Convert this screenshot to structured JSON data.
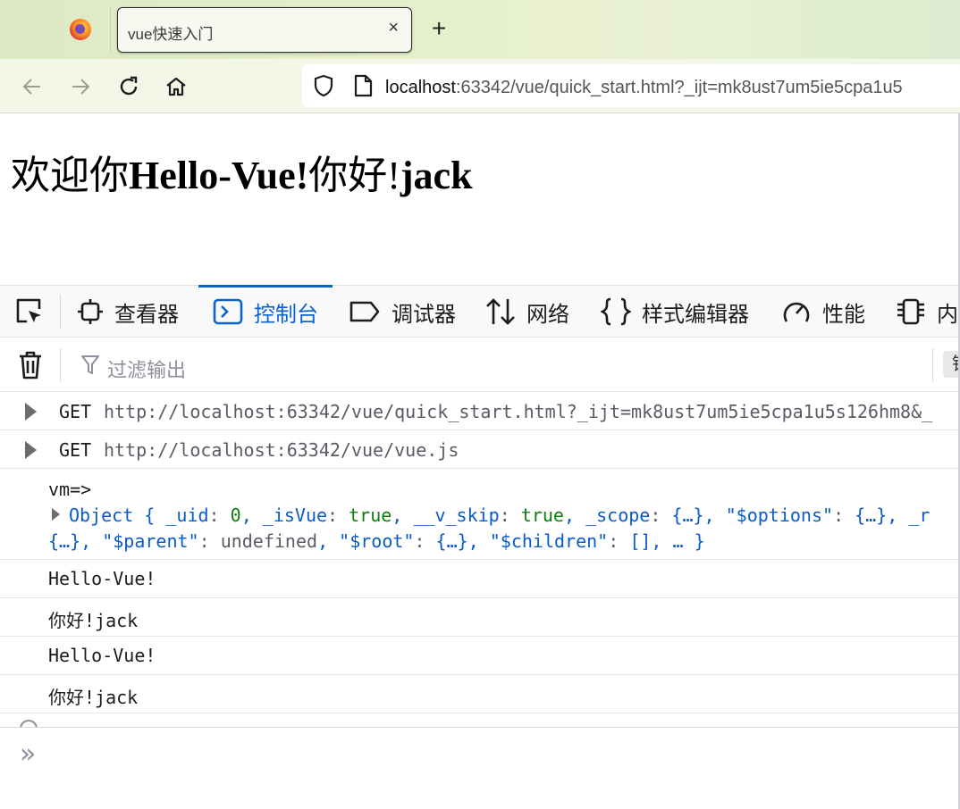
{
  "browser": {
    "tab_title": "vue快速入门",
    "tab_close": "×",
    "new_tab": "+",
    "url_host": "localhost",
    "url_rest": ":63342/vue/quick_start.html?_ijt=mk8ust7um5ie5cpa1u5"
  },
  "page": {
    "heading_welcome": "欢迎你",
    "heading_message": "Hello-Vue!",
    "heading_greeting": "你好!",
    "heading_name": "jack"
  },
  "devtools": {
    "tabs": [
      {
        "label": "查看器",
        "icon": "inspector-icon"
      },
      {
        "label": "控制台",
        "icon": "console-icon",
        "active": true
      },
      {
        "label": "调试器",
        "icon": "debugger-icon"
      },
      {
        "label": "网络",
        "icon": "network-icon"
      },
      {
        "label": "样式编辑器",
        "icon": "style-editor-icon"
      },
      {
        "label": "性能",
        "icon": "performance-icon"
      },
      {
        "label": "内",
        "icon": "memory-icon"
      }
    ],
    "filter_placeholder": "过滤输出",
    "filter_right_label": "错"
  },
  "console": {
    "network": [
      {
        "method": "GET",
        "url": "http://localhost:63342/vue/quick_start.html?_ijt=mk8ust7um5ie5cpa1u5s126hm8&_"
      },
      {
        "method": "GET",
        "url": "http://localhost:63342/vue/vue.js"
      }
    ],
    "object_log": {
      "label": "vm=>",
      "line1": [
        {
          "t": "Object { ",
          "c": "c-blue"
        },
        {
          "t": "_uid",
          "c": "c-blue"
        },
        {
          "t": ": ",
          "c": "c-gray"
        },
        {
          "t": "0",
          "c": "c-green"
        },
        {
          "t": ", ",
          "c": "c-blue"
        },
        {
          "t": "_isVue",
          "c": "c-blue"
        },
        {
          "t": ": ",
          "c": "c-gray"
        },
        {
          "t": "true",
          "c": "c-green"
        },
        {
          "t": ", ",
          "c": "c-blue"
        },
        {
          "t": "__v_skip",
          "c": "c-blue"
        },
        {
          "t": ": ",
          "c": "c-gray"
        },
        {
          "t": "true",
          "c": "c-green"
        },
        {
          "t": ", ",
          "c": "c-blue"
        },
        {
          "t": "_scope",
          "c": "c-blue"
        },
        {
          "t": ": ",
          "c": "c-gray"
        },
        {
          "t": "{…}",
          "c": "c-blue"
        },
        {
          "t": ", ",
          "c": "c-blue"
        },
        {
          "t": "\"$options\"",
          "c": "c-blue"
        },
        {
          "t": ": ",
          "c": "c-gray"
        },
        {
          "t": "{…}",
          "c": "c-blue"
        },
        {
          "t": ", _r",
          "c": "c-blue"
        }
      ],
      "line2": [
        {
          "t": "{…}",
          "c": "c-blue"
        },
        {
          "t": ", ",
          "c": "c-blue"
        },
        {
          "t": "\"$parent\"",
          "c": "c-blue"
        },
        {
          "t": ": ",
          "c": "c-gray"
        },
        {
          "t": "undefined",
          "c": "c-gray"
        },
        {
          "t": ", ",
          "c": "c-blue"
        },
        {
          "t": "\"$root\"",
          "c": "c-blue"
        },
        {
          "t": ": ",
          "c": "c-gray"
        },
        {
          "t": "{…}",
          "c": "c-blue"
        },
        {
          "t": ", ",
          "c": "c-blue"
        },
        {
          "t": "\"$children\"",
          "c": "c-blue"
        },
        {
          "t": ": ",
          "c": "c-gray"
        },
        {
          "t": "[]",
          "c": "c-blue"
        },
        {
          "t": ", … }",
          "c": "c-blue"
        }
      ]
    },
    "logs": [
      "Hello-Vue!",
      "你好!jack",
      "Hello-Vue!",
      "你好!jack"
    ],
    "prompt": "»"
  },
  "colors": {
    "accent": "#0b63cf",
    "tabstrip": "#e6efcc",
    "navbar": "#f3f7e8"
  }
}
